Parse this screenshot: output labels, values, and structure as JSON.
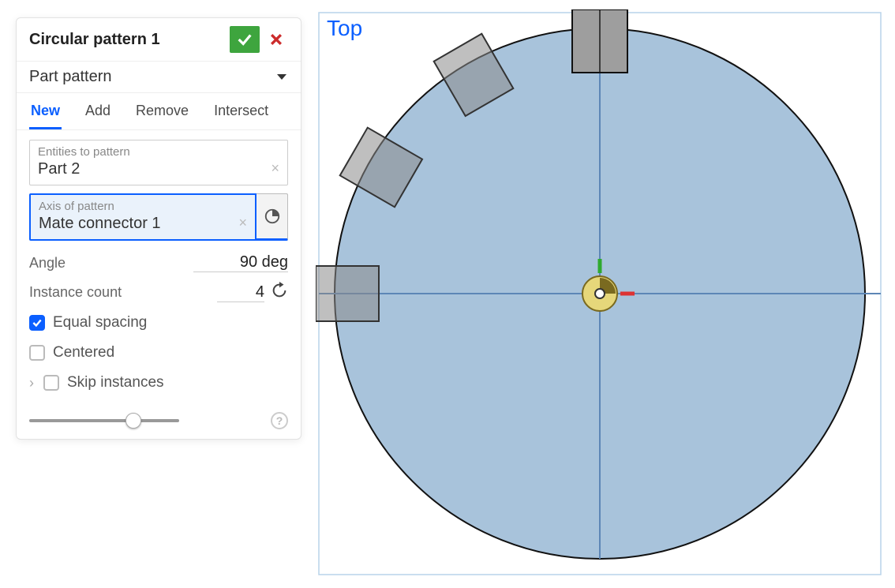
{
  "panel": {
    "title": "Circular pattern 1",
    "pattern_type": "Part pattern",
    "tabs": {
      "new": "New",
      "add": "Add",
      "remove": "Remove",
      "intersect": "Intersect"
    },
    "entities": {
      "label": "Entities to pattern",
      "value": "Part 2"
    },
    "axis": {
      "label": "Axis of pattern",
      "value": "Mate connector 1"
    },
    "angle": {
      "label": "Angle",
      "value": "90 deg"
    },
    "count": {
      "label": "Instance count",
      "value": "4"
    },
    "equal_spacing": "Equal spacing",
    "centered": "Centered",
    "skip_instances": "Skip instances"
  },
  "viewport": {
    "label": "Top"
  },
  "colors": {
    "accent": "#0b5fff",
    "accept": "#3ea53e",
    "cancel": "#cc2b2b",
    "circle_fill": "#a8c3db",
    "part_fill": "#8a8a8a"
  }
}
